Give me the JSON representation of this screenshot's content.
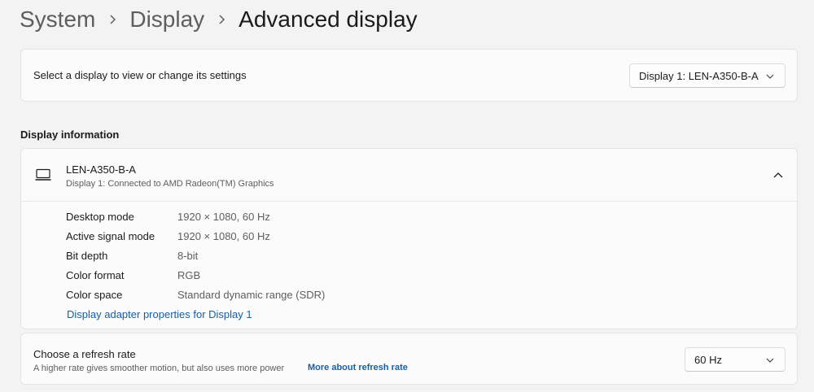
{
  "breadcrumb": {
    "items": [
      "System",
      "Display"
    ],
    "current": "Advanced display"
  },
  "select_display": {
    "label": "Select a display to view or change its settings",
    "selected": "Display 1: LEN-A350-B-A"
  },
  "display_information": {
    "section_title": "Display information",
    "name": "LEN-A350-B-A",
    "connection": "Display 1: Connected to AMD Radeon(TM) Graphics",
    "rows": [
      {
        "key": "Desktop mode",
        "value": "1920 × 1080, 60 Hz"
      },
      {
        "key": "Active signal mode",
        "value": "1920 × 1080, 60 Hz"
      },
      {
        "key": "Bit depth",
        "value": "8-bit"
      },
      {
        "key": "Color format",
        "value": "RGB"
      },
      {
        "key": "Color space",
        "value": "Standard dynamic range (SDR)"
      }
    ],
    "adapter_link": "Display adapter properties for Display 1"
  },
  "refresh_rate": {
    "title": "Choose a refresh rate",
    "description": "A higher rate gives smoother motion, but also uses more power",
    "link": "More about refresh rate",
    "selected": "60 Hz"
  },
  "colors": {
    "accent_link": "#1a5fa6",
    "background": "#f3f3f3",
    "card": "#fbfbfb"
  },
  "icons": {
    "breadcrumb_separator": "chevron-right-icon",
    "dropdown": "chevron-down-icon",
    "collapse": "chevron-up-icon",
    "display": "monitor-icon"
  }
}
